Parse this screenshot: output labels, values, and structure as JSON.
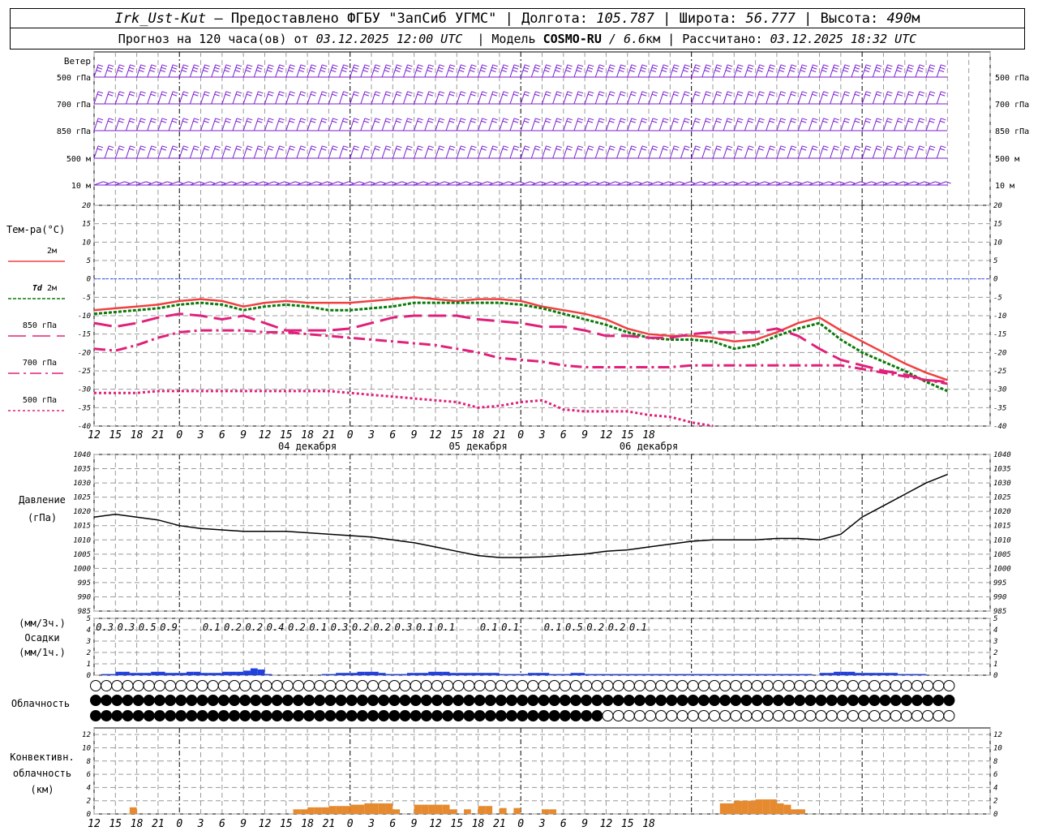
{
  "header": {
    "station": "Irk_Ust-Kut",
    "provided": "– Предоставлено ФГБУ \"ЗапСиб УГМС\" |",
    "lon_label": "Долгота:",
    "lon": "105.787",
    "lat_label": "| Широта:",
    "lat": "56.777",
    "alt_label": "| Высота:",
    "alt": "490",
    "alt_unit": "м",
    "forecast": "Прогноз на 120 часа(ов) от",
    "init": "03.12.2025 12:00 UTC",
    "model_label": "| Модель",
    "model": "COSMO-RU",
    "res": "/ 6.6",
    "res_unit": "км",
    "calc_label": "| Рассчитано:",
    "calc": "03.12.2025 18:32 UTC"
  },
  "wind_panel": {
    "title": "Ветер",
    "levels": [
      "500 гПа",
      "700 гПа",
      "850 гПа",
      "500 м",
      "10  м"
    ]
  },
  "temp_panel": {
    "title": "Тем-ра(°C)",
    "legend": [
      {
        "label": "2м",
        "italic": "",
        "color": "#f04040",
        "dash": "none"
      },
      {
        "label": "2м",
        "italic": "Td",
        "color": "#0a7a0a",
        "dash": "4,2"
      },
      {
        "label": "850 гПа",
        "italic": "",
        "color": "#e0207a",
        "dash": "22,8"
      },
      {
        "label": "700 гПа",
        "italic": "",
        "color": "#e0207a",
        "dash": "14,5,3,5"
      },
      {
        "label": "500 гПа",
        "italic": "",
        "color": "#e0207a",
        "dash": "3,3"
      }
    ]
  },
  "time_axis": {
    "hour_ticks": [
      "12",
      "15",
      "18",
      "21",
      "0",
      "3",
      "6",
      "9",
      "12",
      "15",
      "18",
      "21",
      "0",
      "3",
      "6",
      "9",
      "12",
      "15",
      "18",
      "21",
      "0",
      "3",
      "6",
      "9",
      "12",
      "15",
      "18"
    ],
    "date_labels": [
      "04 декабря",
      "05 декабря",
      "06 декабря"
    ]
  },
  "pressure_panel": {
    "title": "Давление",
    "unit": "(гПа)"
  },
  "precip_panel": {
    "unit_top": "(мм/3ч.)",
    "title": "Осадки",
    "unit_bottom": "(мм/1ч.)"
  },
  "cloud_panel": {
    "title": "Облачность"
  },
  "conv_panel": {
    "title1": "Конвективн.",
    "title2": "облачность",
    "unit": "(км)"
  },
  "colors": {
    "temp2m": "#f04040",
    "td2m": "#0a7a0a",
    "upper": "#e0207a",
    "wind": "#7a1ecf",
    "precip": "#2040e0",
    "conv": "#e68a30",
    "pressure": "#000000",
    "zero_line": "#3050ff"
  },
  "chart_data": [
    {
      "type": "line",
      "title": "Тем-ра(°C)",
      "x_hours": [
        0,
        3,
        6,
        9,
        12,
        15,
        18,
        21,
        24,
        27,
        30,
        33,
        36,
        39,
        42,
        45,
        48,
        51,
        54,
        57,
        60,
        63,
        66,
        69,
        72,
        75,
        78,
        81,
        84,
        87,
        90,
        93,
        96,
        99,
        102,
        105,
        108,
        111,
        114,
        117,
        120
      ],
      "ylim": [
        -40,
        20
      ],
      "series": [
        {
          "name": "2м",
          "values": [
            -8.5,
            -8,
            -7.5,
            -7,
            -6,
            -5.5,
            -6,
            -7.5,
            -6.5,
            -6,
            -6.5,
            -6.5,
            -6.5,
            -6,
            -5.5,
            -5,
            -5.5,
            -6,
            -5.5,
            -5.5,
            -6,
            -7.5,
            -8.5,
            -9.5,
            -11,
            -13.5,
            -15,
            -15.5,
            -15.5,
            -16,
            -17,
            -16.5,
            -14.5,
            -12,
            -10.5,
            -14,
            -17,
            -20,
            -23,
            -25.5,
            -27.5
          ]
        },
        {
          "name": "Td 2м",
          "values": [
            -9.5,
            -9,
            -8.5,
            -8,
            -7,
            -6.5,
            -7,
            -8.5,
            -7.5,
            -7,
            -7.5,
            -8.5,
            -8.5,
            -8,
            -7.5,
            -6.5,
            -6.5,
            -6.5,
            -6.5,
            -6.5,
            -7,
            -8,
            -9.5,
            -11,
            -12.5,
            -14.5,
            -16,
            -16.5,
            -16.5,
            -17,
            -19,
            -18,
            -15.5,
            -13.5,
            -12,
            -16.5,
            -20,
            -22.5,
            -25,
            -28,
            -30.5
          ]
        },
        {
          "name": "850 гПа",
          "values": [
            -12,
            -13,
            -12,
            -10.5,
            -9.5,
            -10,
            -11,
            -10,
            -12,
            -14,
            -14,
            -14,
            -13.5,
            -12,
            -10.5,
            -10,
            -10,
            -10,
            -11,
            -11.5,
            -12,
            -13,
            -13,
            -14,
            -15.5,
            -15.5,
            -16,
            -16,
            -15,
            -14.5,
            -14.5,
            -14.5,
            -13.5,
            -15.5,
            -19,
            -22,
            -23.5,
            -25,
            -26,
            -27.5,
            -28
          ]
        },
        {
          "name": "700 гПа",
          "values": [
            -19,
            -19.5,
            -18,
            -16,
            -14.5,
            -14,
            -14,
            -14,
            -14.5,
            -14.5,
            -15,
            -15.5,
            -16,
            -16.5,
            -17,
            -17.5,
            -18,
            -19,
            -20,
            -21.5,
            -22,
            -22.5,
            -23.5,
            -24,
            -24,
            -24,
            -24,
            -24,
            -23.5,
            -23.5,
            -23.5,
            -23.5,
            -23.5,
            -23.5,
            -23.5,
            -23.5,
            -24.5,
            -25.5,
            -26.5,
            -27.5,
            -28.5
          ]
        },
        {
          "name": "500 гПа",
          "values": [
            -31,
            -31,
            -31,
            -30.5,
            -30.5,
            -30.5,
            -30.5,
            -30.5,
            -30.5,
            -30.5,
            -30.5,
            -30.5,
            -31,
            -31.5,
            -32,
            -32.5,
            -33,
            -33.5,
            -35,
            -34.5,
            -33.5,
            -33,
            -35.5,
            -36,
            -36,
            -36,
            -37,
            -37.5,
            -39,
            -40,
            -41,
            -42,
            -43,
            -44,
            -45,
            -46,
            -47,
            -48,
            -49,
            -50,
            -51
          ]
        }
      ]
    },
    {
      "type": "line",
      "title": "Давление",
      "ylabel": "(гПа)",
      "ylim": [
        985,
        1040
      ],
      "x_hours": [
        0,
        3,
        6,
        9,
        12,
        15,
        18,
        21,
        24,
        27,
        30,
        33,
        36,
        39,
        42,
        45,
        48,
        51,
        54,
        57,
        60,
        63,
        66,
        69,
        72,
        75,
        78,
        81,
        84,
        87,
        90,
        93,
        96,
        99,
        102,
        105,
        108,
        111,
        114,
        117,
        120
      ],
      "series": [
        {
          "name": "Давление",
          "values": [
            1018,
            1019,
            1018,
            1017,
            1015,
            1014,
            1013.5,
            1013,
            1013,
            1013,
            1012.5,
            1012,
            1011.5,
            1011,
            1010,
            1009,
            1007.5,
            1006,
            1004.5,
            1003.8,
            1003.8,
            1004,
            1004.5,
            1005,
            1006,
            1006.5,
            1007.5,
            1008.5,
            1009.5,
            1010,
            1010,
            1010,
            1010.5,
            1010.5,
            1010,
            1012,
            1018,
            1022,
            1026,
            1030,
            1033
          ]
        }
      ]
    },
    {
      "type": "bar",
      "title": "Осадки",
      "ylabel": "(мм/1ч.)",
      "ylim": [
        0,
        5
      ],
      "x_hours": [
        0,
        1,
        2,
        3,
        4,
        5,
        6,
        7,
        8,
        9,
        10,
        11,
        12,
        13,
        14,
        15,
        16,
        17,
        18,
        19,
        20,
        21,
        22,
        23,
        24,
        25,
        26,
        27,
        28,
        29,
        30,
        31,
        32,
        33,
        34,
        35,
        36,
        37,
        38,
        39,
        40,
        41,
        42,
        43,
        44,
        45,
        46,
        47,
        48,
        49,
        50,
        51,
        52,
        53,
        54,
        55,
        56,
        57,
        58,
        59,
        60,
        61,
        62,
        63,
        64,
        65,
        66,
        67,
        68,
        69,
        70,
        71,
        72,
        73,
        74,
        75,
        76,
        77,
        78,
        79,
        80,
        81,
        82,
        83,
        84,
        85,
        86,
        87,
        88,
        89,
        90,
        91,
        92,
        93,
        94,
        95,
        96,
        97,
        98,
        99,
        100,
        101,
        102,
        103,
        104,
        105,
        106,
        107,
        108,
        109,
        110,
        111,
        112,
        113,
        114,
        115,
        116,
        117,
        118,
        119
      ],
      "values": [
        0,
        0.1,
        0.1,
        0.3,
        0.3,
        0.2,
        0.2,
        0.2,
        0.3,
        0.3,
        0.2,
        0.2,
        0.2,
        0.3,
        0.3,
        0.2,
        0.2,
        0.2,
        0.3,
        0.3,
        0.3,
        0.4,
        0.6,
        0.5,
        0.1,
        0,
        0,
        0,
        0,
        0,
        0,
        0,
        0.1,
        0.1,
        0.2,
        0.2,
        0.2,
        0.3,
        0.3,
        0.3,
        0.2,
        0.1,
        0.1,
        0.1,
        0.2,
        0.2,
        0.2,
        0.3,
        0.3,
        0.3,
        0.2,
        0.2,
        0.2,
        0.2,
        0.2,
        0.2,
        0.2,
        0.1,
        0.1,
        0.1,
        0.1,
        0.2,
        0.2,
        0.2,
        0.1,
        0.1,
        0.1,
        0.2,
        0.2,
        0.1,
        0.1,
        0.1,
        0.1,
        0.1,
        0.1,
        0.1,
        0.1,
        0.1,
        0.1,
        0.1,
        0.1,
        0.1,
        0.1,
        0.1,
        0.1,
        0.1,
        0.1,
        0.1,
        0.1,
        0.1,
        0.1,
        0.1,
        0.1,
        0.1,
        0.1,
        0.1,
        0.1,
        0.1,
        0.1,
        0.1,
        0.1,
        0,
        0.2,
        0.2,
        0.3,
        0.3,
        0.3,
        0.2,
        0.2,
        0.2,
        0.2,
        0.2,
        0.2,
        0.1,
        0.1,
        0.1,
        0.1,
        0,
        0,
        0,
        0,
        0
      ],
      "labels": [
        {
          "hour": 1.5,
          "text": "0.3"
        },
        {
          "hour": 4.5,
          "text": "0.3"
        },
        {
          "hour": 7.5,
          "text": "0.5"
        },
        {
          "hour": 10.5,
          "text": "0.9"
        },
        {
          "hour": 16.5,
          "text": "0.1"
        },
        {
          "hour": 19.5,
          "text": "0.2"
        },
        {
          "hour": 22.5,
          "text": "0.2"
        },
        {
          "hour": 25.5,
          "text": "0.4"
        },
        {
          "hour": 28.5,
          "text": "0.2"
        },
        {
          "hour": 31.5,
          "text": "0.1"
        },
        {
          "hour": 34.5,
          "text": "0.3"
        },
        {
          "hour": 37.5,
          "text": "0.2"
        },
        {
          "hour": 40.5,
          "text": "0.2"
        },
        {
          "hour": 43.5,
          "text": "0.3"
        },
        {
          "hour": 46.5,
          "text": "0.1"
        },
        {
          "hour": 49.5,
          "text": "0.1"
        },
        {
          "hour": 55.5,
          "text": "0.1"
        },
        {
          "hour": 58.5,
          "text": "0.1"
        },
        {
          "hour": 64.5,
          "text": "0.1"
        },
        {
          "hour": 67.5,
          "text": "0.5"
        },
        {
          "hour": 70.5,
          "text": "0.2"
        },
        {
          "hour": 73.5,
          "text": "0.2"
        },
        {
          "hour": 76.5,
          "text": "0.1"
        }
      ]
    },
    {
      "type": "bar",
      "title": "Конвективн. облачность",
      "ylabel": "(км)",
      "ylim": [
        0,
        13
      ],
      "x_hours": [
        0,
        1,
        2,
        3,
        4,
        5,
        6,
        7,
        8,
        9,
        10,
        11,
        12,
        13,
        14,
        15,
        16,
        17,
        18,
        19,
        20,
        21,
        22,
        23,
        24,
        25,
        26,
        27,
        28,
        29,
        30,
        31,
        32,
        33,
        34,
        35,
        36,
        37,
        38,
        39,
        40,
        41,
        42,
        43,
        44,
        45,
        46,
        47,
        48,
        49,
        50,
        51,
        52,
        53,
        54,
        55,
        56,
        57,
        58,
        59,
        60,
        61,
        62,
        63,
        64,
        65,
        66,
        67,
        68,
        69,
        70,
        71,
        72,
        73,
        74,
        75,
        76,
        77,
        78,
        79,
        80,
        81,
        82,
        83,
        84,
        85,
        86,
        87,
        88,
        89,
        90,
        91,
        92,
        93,
        94,
        95,
        96,
        97,
        98,
        99,
        100,
        101,
        102,
        103,
        104,
        105,
        106,
        107,
        108,
        109,
        110,
        111,
        112,
        113,
        114,
        115,
        116,
        117,
        118,
        119
      ],
      "values": [
        0,
        0,
        0,
        0,
        0,
        0.6,
        0,
        0,
        0,
        0,
        0,
        0,
        0,
        0,
        0,
        0,
        0,
        0,
        0,
        0,
        0,
        0,
        0,
        0,
        0,
        0,
        0,
        0,
        0.3,
        0.3,
        0.6,
        0.6,
        0.6,
        0.8,
        0.8,
        0.8,
        1.0,
        1.0,
        1.2,
        1.2,
        1.2,
        1.2,
        0.3,
        0,
        0,
        1.0,
        1.0,
        1.0,
        1.0,
        1.0,
        0.3,
        0,
        0.3,
        0,
        0.8,
        0.8,
        0,
        0.5,
        0,
        0.5,
        0,
        0,
        0,
        0.3,
        0.3,
        0,
        0,
        0,
        0,
        0,
        0,
        0,
        0,
        0,
        0,
        0,
        0,
        0,
        0,
        0,
        0,
        0,
        0,
        0,
        0,
        0,
        0,
        0,
        1.2,
        1.2,
        1.6,
        1.6,
        1.6,
        1.8,
        1.8,
        1.8,
        1.2,
        1.0,
        0.3,
        0.3,
        0,
        0,
        0,
        0,
        0,
        0,
        0,
        0,
        0,
        0,
        0,
        0,
        0,
        0,
        0,
        0,
        0,
        0,
        0,
        0,
        0,
        0
      ],
      "note_hours": [
        0,
        3,
        6,
        9,
        12,
        15,
        18,
        21,
        24,
        27,
        30,
        33,
        36,
        39,
        42,
        45,
        48,
        51,
        54,
        57,
        60,
        63,
        66,
        69,
        72,
        75,
        78,
        81,
        84,
        87,
        90,
        93,
        96,
        99,
        102,
        105,
        108,
        111,
        114,
        117,
        120
      ]
    }
  ]
}
